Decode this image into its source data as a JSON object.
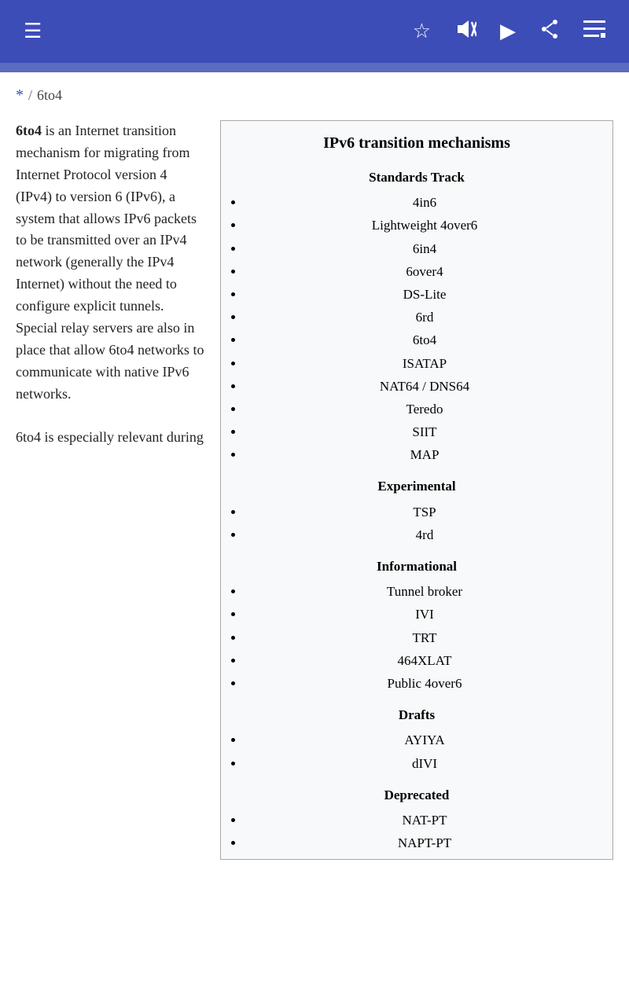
{
  "navbar": {
    "hamburger_label": "☰",
    "star_label": "☆",
    "mute_label": "🔇",
    "play_label": "▶",
    "share_label": "share",
    "menu_label": "≡"
  },
  "breadcrumb": {
    "star": "*",
    "separator": "/",
    "current": "6to4"
  },
  "left_text": {
    "bold_term": "6to4",
    "paragraph1": " is an Internet transition mechanism for migrating from Internet Protocol version 4 (IPv4) to version 6 (IPv6), a system that allows IPv6 packets to be transmitted over an IPv4 network (generally the IPv4 Internet) without the need to configure explicit tunnels. Special relay servers are also in place that allow 6to4 networks to communicate with native IPv6 networks.",
    "paragraph2": "6to4 is especially relevant during"
  },
  "infobox": {
    "title": "IPv6 transition mechanisms",
    "sections": [
      {
        "header": "Standards Track",
        "items": [
          "4in6",
          "Lightweight 4over6",
          "6in4",
          "6over4",
          "DS-Lite",
          "6rd",
          "6to4",
          "ISATAP",
          "NAT64 / DNS64",
          "Teredo",
          "SIIT",
          "MAP"
        ]
      },
      {
        "header": "Experimental",
        "items": [
          "TSP",
          "4rd"
        ]
      },
      {
        "header": "Informational",
        "items": [
          "Tunnel broker",
          "IVI",
          "TRT",
          "464XLAT",
          "Public 4over6"
        ]
      },
      {
        "header": "Drafts",
        "items": [
          "AYIYA",
          "dIVI"
        ]
      },
      {
        "header": "Deprecated",
        "items": [
          "NAT-PT",
          "NAPT-PT"
        ]
      }
    ]
  }
}
